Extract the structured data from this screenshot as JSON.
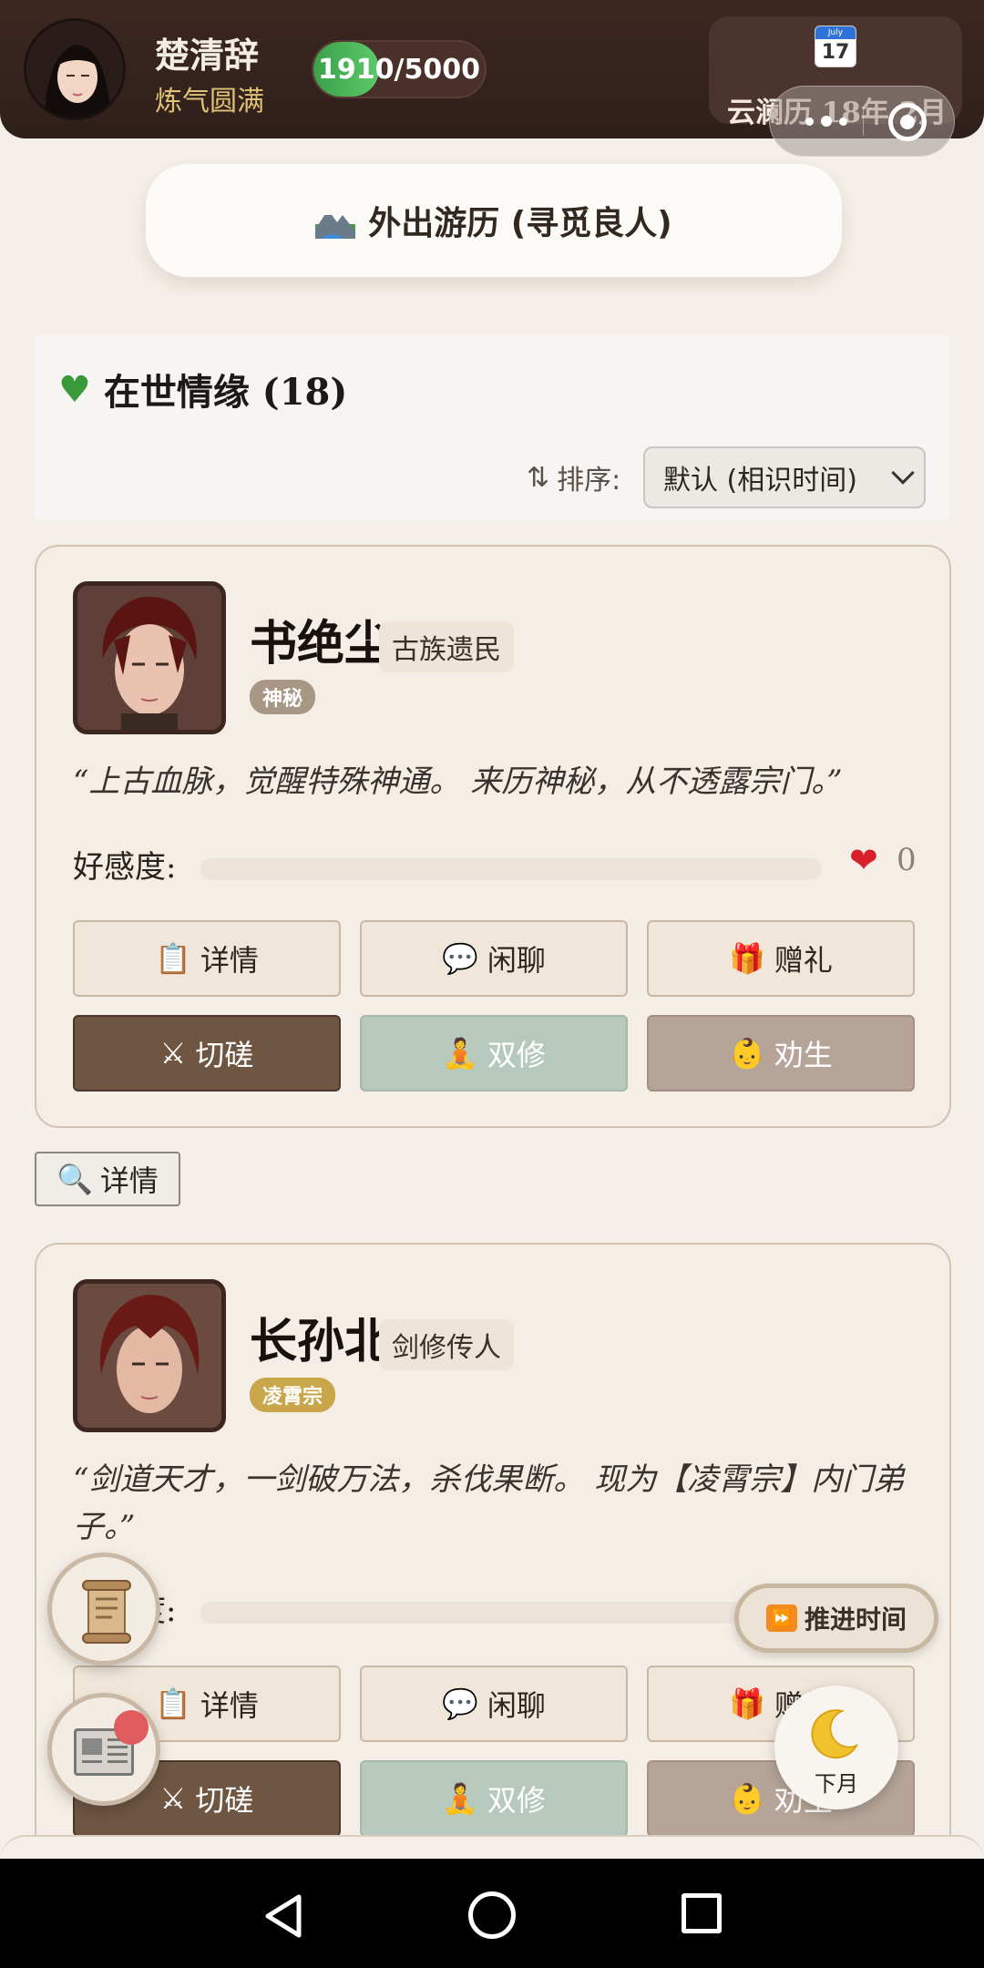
{
  "player": {
    "name": "楚清辞",
    "rank": "炼气圆满",
    "xp_text": "1910/5000",
    "xp_fraction": 0.382
  },
  "calendar": {
    "month_label": "July",
    "day": "17",
    "date_text": "云澜历 18年 2月"
  },
  "travel": {
    "icon": "mountain-icon",
    "label": "外出游历 (寻觅良人)"
  },
  "section": {
    "title": "在世情缘 (18)",
    "sort_label": "排序:",
    "sort_value": "默认 (相识时间)"
  },
  "characters": [
    {
      "name": "书绝尘",
      "title": "古族遗民",
      "tag": "神秘",
      "tag_color": "#a89784",
      "quote": "“上古血脉，觉醒特殊神通。 来历神秘，从不透露宗门。”",
      "favor_label": "好感度:",
      "favor_value": "0",
      "favor_fraction": 0
    },
    {
      "name": "长孙北",
      "title": "剑修传人",
      "tag": "凌霄宗",
      "tag_color": "#c9a64a",
      "quote": "“剑道天才，一剑破万法，杀伐果断。 现为【凌霄宗】内门弟子。”",
      "favor_label": "好感度:"
    }
  ],
  "buttons": {
    "detail": "详情",
    "chat": "闲聊",
    "gift": "赠礼",
    "spar": "切磋",
    "dual": "双修",
    "persuade": "劝生"
  },
  "detail_link": "详情",
  "floating": {
    "advance_time": "推进时间",
    "next_month": "下月"
  },
  "colors": {
    "header_bg": "#3d2721",
    "accent_gold": "#e0c274",
    "xp_green": "#3aa04a",
    "btn_dark": "#6e5642",
    "btn_teal": "#b7c9bd",
    "btn_taupe": "#b5a497",
    "heart_red": "#d81f2a"
  }
}
